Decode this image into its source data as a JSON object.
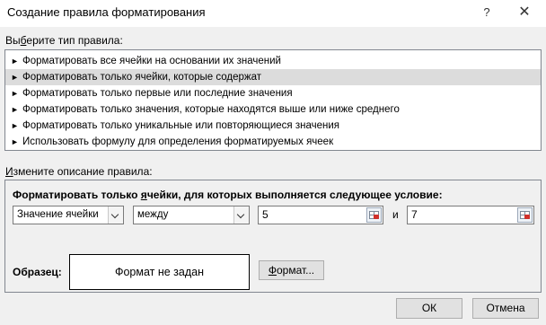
{
  "window": {
    "title": "Создание правила форматирования",
    "help_glyph": "?",
    "close_glyph": "✕"
  },
  "rule_type": {
    "label_pre": "Вы",
    "label_ul": "б",
    "label_post": "ерите тип правила:",
    "items": [
      {
        "label": "Форматировать все ячейки на основании их значений",
        "selected": false
      },
      {
        "label": "Форматировать только ячейки, которые содержат",
        "selected": true
      },
      {
        "label": "Форматировать только первые или последние значения",
        "selected": false
      },
      {
        "label": "Форматировать только значения, которые находятся выше или ниже среднего",
        "selected": false
      },
      {
        "label": "Форматировать только уникальные или повторяющиеся значения",
        "selected": false
      },
      {
        "label": "Использовать формулу для определения форматируемых ячеек",
        "selected": false
      }
    ],
    "item_icon": "arrow-right-icon"
  },
  "description": {
    "label_ul": "И",
    "label_post": "змените описание правила:",
    "heading_pre": "Форматировать только ",
    "heading_ul": "я",
    "heading_post": "чейки, для которых выполняется следующее условие:",
    "cell_value_select": "Значение ячейки",
    "operator_select": "между",
    "value1": "5",
    "and_label": "и",
    "value2": "7",
    "sample_label": "Образец:",
    "sample_text": "Формат не задан",
    "format_button_ul": "Ф",
    "format_button_post": "ормат..."
  },
  "buttons": {
    "ok": "ОК",
    "cancel": "Отмена"
  },
  "colors": {
    "selected_row": "#dcdcdc",
    "dialog_bg": "#f0f0f0",
    "border": "#828790"
  }
}
